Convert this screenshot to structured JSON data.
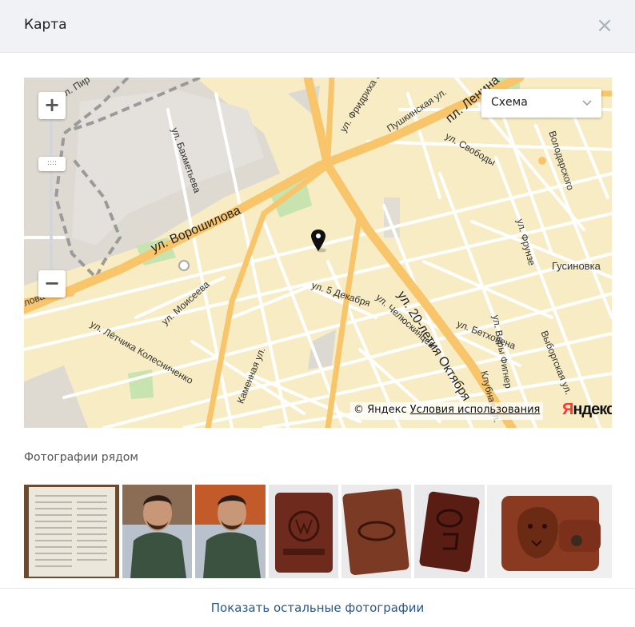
{
  "header": {
    "title": "Карта",
    "close_symbol": "×"
  },
  "map": {
    "layer_select": "Схема",
    "copyright": "© Яндекс",
    "terms_link": "Условия использования",
    "logo_red": "Я",
    "logo_dark": "ндекс",
    "zoom_in": "+",
    "zoom_out": "−",
    "zoom_handle": "::::",
    "streets": {
      "voroshilova": "ул. Ворошилова",
      "oktyabrya": "ул. 20-летия Октября",
      "bakhmeteva": "ул. Бахметьева",
      "moiseeva": "ул. Моисеева",
      "kolesnichenko": "ул. Лётчика Колесниченко",
      "dekabrya": "ул. 5 Декабря",
      "chelyuskintsev": "ул. Челюскинцев",
      "fridrikha": "ул. Фридриха Э",
      "pushkinskaya": "Пушкинская ул.",
      "lenina": "пл. Ленина",
      "svobody": "ул. Свободы",
      "volodarskogo": "Володарского",
      "frunze": "ул. Фрунзе",
      "gusinovka": "Гусиновка",
      "very_figner": "ул. Веры Фигнер",
      "betkhovena": "ул. Бетховена",
      "klubnaya": "Клубная ул.",
      "vyborgskaya": "Выборгская ул.",
      "kamennaya": "Каменная ул.",
      "pir": "ул. Пир",
      "vo": "ловa"
    }
  },
  "photos": {
    "title": "Фотографии рядом",
    "items": [
      {
        "label": "document-photo"
      },
      {
        "label": "man-selfie-photo"
      },
      {
        "label": "man-selfie-photo"
      },
      {
        "label": "leather-cover-vw-photo"
      },
      {
        "label": "leather-cover-ford-photo"
      },
      {
        "label": "leather-cover-mazda-photo"
      },
      {
        "label": "leather-wallet-lion-photo"
      }
    ]
  },
  "footer": {
    "show_more": "Показать остальные фотографии"
  },
  "colors": {
    "accent": "#2a5885",
    "road_major": "#f9c56b",
    "map_bg": "#f7ecc4",
    "header_bg": "#f0f2f5"
  }
}
